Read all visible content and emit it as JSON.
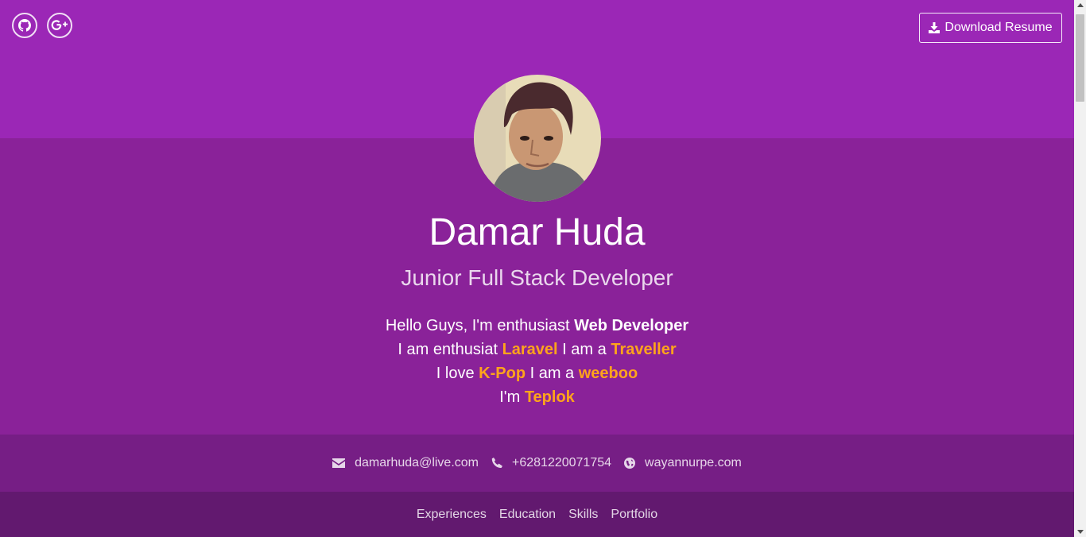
{
  "header": {
    "social": [
      {
        "name": "github",
        "icon": "github-icon"
      },
      {
        "name": "google-plus",
        "icon": "google-plus-icon"
      }
    ],
    "download_label": "Download Resume",
    "download_icon": "download-icon"
  },
  "profile": {
    "avatar_icon": "profile-photo",
    "name": "Damar Huda",
    "title": "Junior Full Stack Developer"
  },
  "bio": {
    "line1_text": "Hello Guys, I'm enthusiast ",
    "line1_bold": "Web Developer",
    "line2_text1": "I am enthusiat ",
    "line2_hl1": "Laravel",
    "line2_text2": " I am a ",
    "line2_hl2": "Traveller",
    "line3_text1": "I love ",
    "line3_hl1": "K-Pop",
    "line3_text2": " I am a ",
    "line3_hl2": "weeboo",
    "line4_text1": "I'm ",
    "line4_hl1": "Teplok"
  },
  "contacts": [
    {
      "icon": "envelope-icon",
      "value": "damarhuda@live.com"
    },
    {
      "icon": "phone-icon",
      "value": "+6281220071754"
    },
    {
      "icon": "globe-icon",
      "value": "wayannurpe.com"
    }
  ],
  "nav": [
    "Experiences",
    "Education",
    "Skills",
    "Portfolio"
  ],
  "colors": {
    "top": "#9b27b6",
    "hero": "#8a2299",
    "contact_bar": "#761e85",
    "nav_bar": "#62196f",
    "highlight": "#ffa41b"
  }
}
